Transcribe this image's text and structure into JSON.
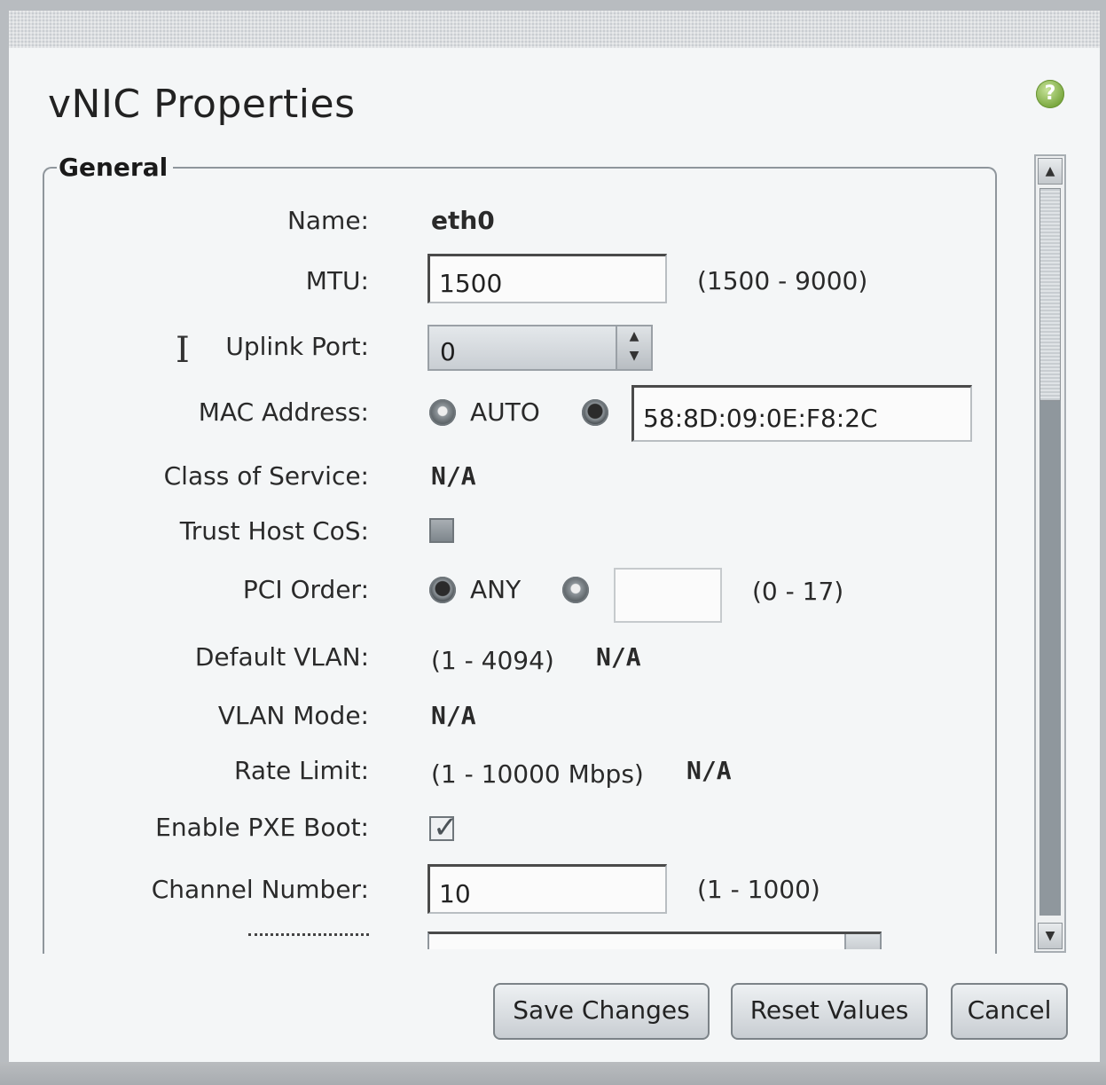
{
  "dialog": {
    "title": "vNIC Properties",
    "help_glyph": "?",
    "section_label": "General"
  },
  "fields": {
    "name": {
      "label": "Name:",
      "value": "eth0"
    },
    "mtu": {
      "label": "MTU:",
      "value": "1500",
      "range": "(1500 - 9000)"
    },
    "uplink_port": {
      "label": "Uplink Port:",
      "value": "0"
    },
    "mac_address": {
      "label": "MAC Address:",
      "auto_label": "AUTO",
      "value": "58:8D:09:0E:F8:2C",
      "selected": "manual"
    },
    "class_of_service": {
      "label": "Class of Service:",
      "value": "N/A"
    },
    "trust_host_cos": {
      "label": "Trust Host CoS:",
      "checked": false
    },
    "pci_order": {
      "label": "PCI Order:",
      "any_label": "ANY",
      "value": "",
      "range": "(0 - 17)",
      "selected": "any"
    },
    "default_vlan": {
      "label": "Default VLAN:",
      "range": "(1 - 4094)",
      "value": "N/A"
    },
    "vlan_mode": {
      "label": "VLAN Mode:",
      "value": "N/A"
    },
    "rate_limit": {
      "label": "Rate Limit:",
      "range": "(1 - 10000 Mbps)",
      "value": "N/A"
    },
    "enable_pxe_boot": {
      "label": "Enable PXE Boot:",
      "checked": true
    },
    "channel_number": {
      "label": "Channel Number:",
      "value": "10",
      "range": "(1 - 1000)"
    }
  },
  "buttons": {
    "save": "Save Changes",
    "reset": "Reset Values",
    "cancel": "Cancel"
  },
  "icons": {
    "help": "help-icon",
    "spinner": "spinner-arrows-icon",
    "scroll_up": "scroll-up-arrow-icon",
    "scroll_down": "scroll-down-arrow-icon",
    "cursor": "text-cursor-icon"
  },
  "colors": {
    "help_green": "#7aa83f",
    "dialog_bg": "#f4f6f7"
  }
}
